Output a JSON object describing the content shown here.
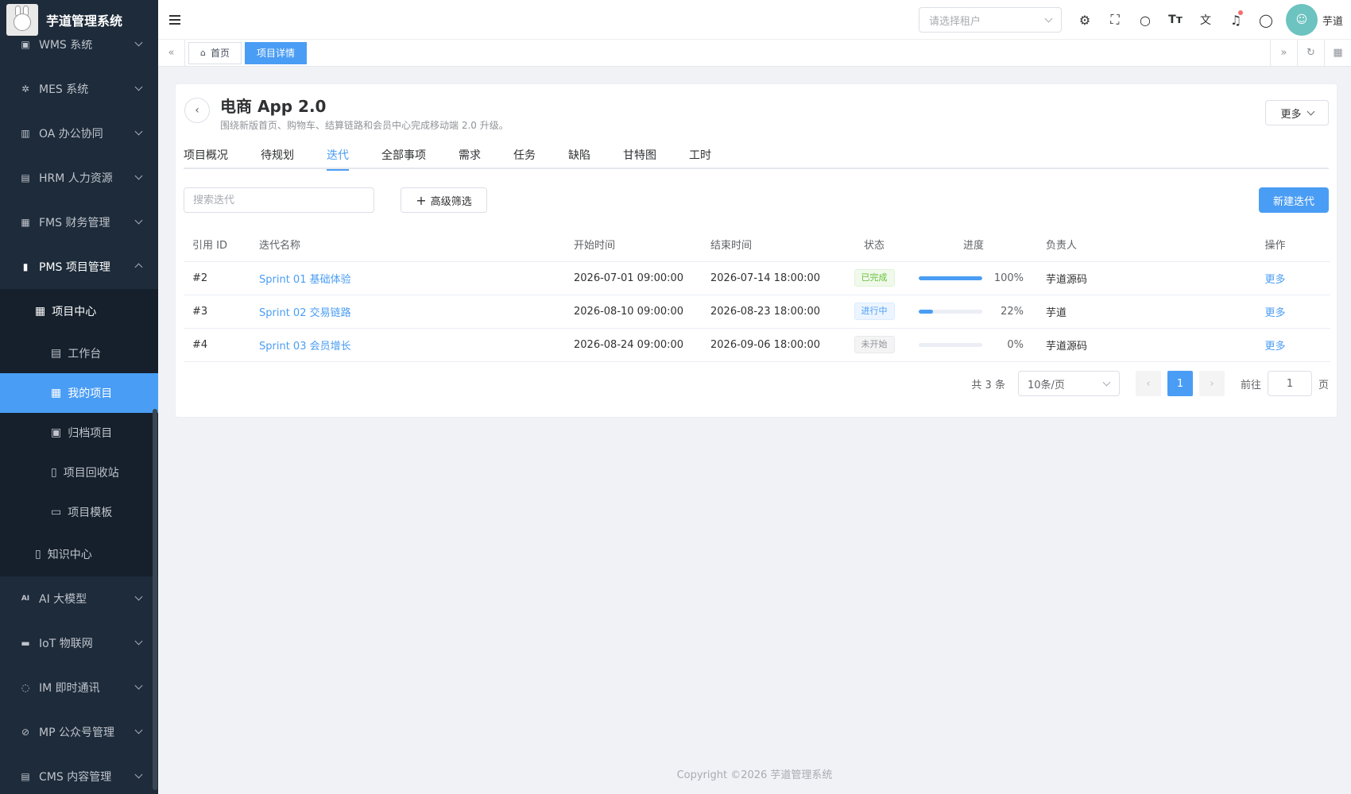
{
  "app": {
    "title": "芋道管理系统"
  },
  "sidebar": {
    "items": [
      {
        "label": "WMS 系统",
        "icon": "box-icon"
      },
      {
        "label": "MES 系统",
        "icon": "chip-icon"
      },
      {
        "label": "OA 办公协同",
        "icon": "building-icon"
      },
      {
        "label": "HRM 人力资源",
        "icon": "office-icon"
      },
      {
        "label": "FMS 财务管理",
        "icon": "money-icon"
      },
      {
        "label": "PMS 项目管理",
        "icon": "chart-icon"
      }
    ],
    "pms_children": {
      "project_center": "项目中心",
      "sub": [
        "工作台",
        "我的项目",
        "归档项目",
        "项目回收站",
        "项目模板"
      ],
      "knowledge_center": "知识中心"
    },
    "bottom_items": [
      {
        "label": "AI 大模型",
        "icon": "ai-icon"
      },
      {
        "label": "IoT 物联网",
        "icon": "router-icon"
      },
      {
        "label": "IM 即时通讯",
        "icon": "chat-icon"
      },
      {
        "label": "MP 公众号管理",
        "icon": "compass-icon"
      },
      {
        "label": "CMS 内容管理",
        "icon": "doc-icon"
      }
    ]
  },
  "header": {
    "tenant_placeholder": "请选择租户",
    "user_name": "芋道"
  },
  "tags": [
    {
      "label": "首页",
      "active": false
    },
    {
      "label": "项目详情",
      "active": true
    }
  ],
  "project": {
    "title": "电商 App 2.0",
    "description": "围绕新版首页、购物车、结算链路和会员中心完成移动端 2.0 升级。",
    "more_label": "更多"
  },
  "tabs": [
    "项目概况",
    "待规划",
    "迭代",
    "全部事项",
    "需求",
    "任务",
    "缺陷",
    "甘特图",
    "工时"
  ],
  "active_tab": "迭代",
  "toolbar": {
    "search_placeholder": "搜索迭代",
    "filter_label": "高级筛选",
    "new_label": "新建迭代"
  },
  "table": {
    "columns": [
      "引用 ID",
      "迭代名称",
      "开始时间",
      "结束时间",
      "状态",
      "进度",
      "负责人",
      "操作"
    ],
    "rows": [
      {
        "id": "#2",
        "name": "Sprint 01 基础体验",
        "start": "2026-07-01 09:00:00",
        "end": "2026-07-14 18:00:00",
        "status": "已完成",
        "status_type": "done",
        "progress": 100,
        "progress_text": "100%",
        "owner": "芋道源码",
        "action": "更多"
      },
      {
        "id": "#3",
        "name": "Sprint 02 交易链路",
        "start": "2026-08-10 09:00:00",
        "end": "2026-08-23 18:00:00",
        "status": "进行中",
        "status_type": "doing",
        "progress": 22,
        "progress_text": "22%",
        "owner": "芋道",
        "action": "更多"
      },
      {
        "id": "#4",
        "name": "Sprint 03 会员增长",
        "start": "2026-08-24 09:00:00",
        "end": "2026-09-06 18:00:00",
        "status": "未开始",
        "status_type": "todo",
        "progress": 0,
        "progress_text": "0%",
        "owner": "芋道源码",
        "action": "更多"
      }
    ]
  },
  "pagination": {
    "total_text": "共 3 条",
    "page_size": "10条/页",
    "current_page": "1",
    "goto_label": "前往",
    "goto_value": "1",
    "page_suffix": "页"
  },
  "footer": {
    "copyright": "Copyright ©2026 芋道管理系统"
  },
  "colors": {
    "primary": "#4a9df4",
    "sidebar_bg": "#1d2b3a",
    "success": "#67c23a"
  }
}
